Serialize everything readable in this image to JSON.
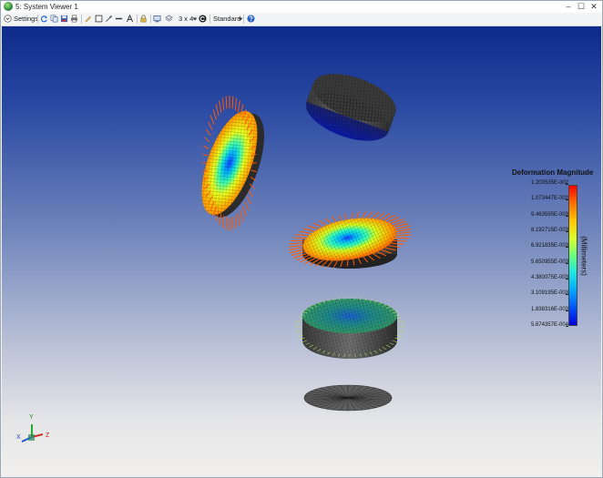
{
  "window": {
    "title": "5: System Viewer 1",
    "controls": [
      "–",
      "☐",
      "✕"
    ]
  },
  "toolbar": {
    "settings_label": "Settings",
    "layout_label": "3 x 4",
    "view_label": "Standard"
  },
  "legend": {
    "title": "Deformation Magnitude",
    "unit": "(Millimeters)",
    "labels": [
      "1.200535E-002",
      "1.073447E-002",
      "9.463595E-003",
      "8.192715E-003",
      "6.921835E-003",
      "5.650955E-003",
      "4.380075E-003",
      "3.109195E-003",
      "1.838316E-003",
      "5.674357E-004"
    ]
  },
  "axes": {
    "x": "X",
    "y": "Y",
    "z": "Z"
  },
  "colors": {
    "viewport_top": "#0e2a8a",
    "viewport_bottom": "#f1f0ee"
  }
}
